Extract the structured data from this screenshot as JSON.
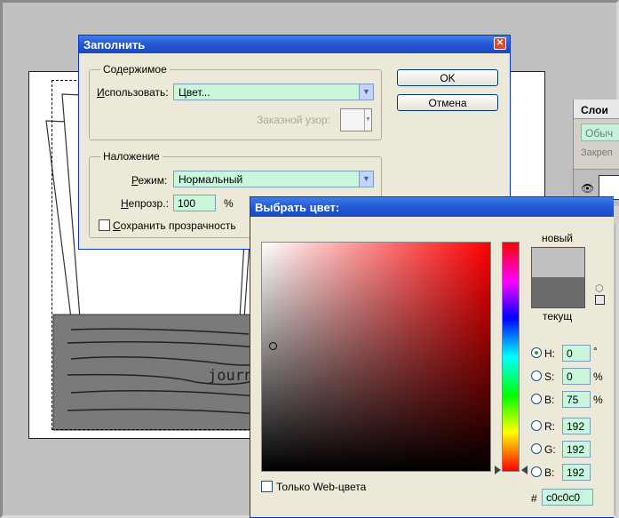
{
  "layers_panel": {
    "tab_label": "Слои",
    "blend_mode": "Обыч",
    "lock_label": "Закреп"
  },
  "artwork": {
    "visible_text": "journ"
  },
  "fill_dialog": {
    "title": "Заполнить",
    "contents_group": "Содержимое",
    "use_label_u": "И",
    "use_label_rest": "спользовать:",
    "use_value": "Цвет...",
    "custom_pattern_label": "Заказной узор:",
    "blending_group": "Наложение",
    "mode_label_u": "Р",
    "mode_label_rest": "ежим:",
    "mode_value": "Нормальный",
    "opacity_label_u": "Н",
    "opacity_label_rest": "епрозр.:",
    "opacity_value": "100",
    "opacity_unit": "%",
    "preserve_transparency_u": "С",
    "preserve_transparency_rest": "охранить прозрачность",
    "ok_label": "OK",
    "cancel_label": "Отмена"
  },
  "color_picker": {
    "title": "Выбрать цвет:",
    "new_label": "новый",
    "current_label": "текущ",
    "web_only_label": "Только Web-цвета",
    "new_color": "#c0c0c0",
    "current_color": "#6b6b6b",
    "fields": {
      "h_label": "H:",
      "h_value": "0",
      "h_unit": "°",
      "s_label": "S:",
      "s_value": "0",
      "s_unit": "%",
      "b_label": "B:",
      "b_value": "75",
      "b_unit": "%",
      "r_label": "R:",
      "r_value": "192",
      "g_label": "G:",
      "g_value": "192",
      "bl_label": "B:",
      "bl_value": "192"
    },
    "hash_label": "#",
    "hex_value": "c0c0c0"
  }
}
